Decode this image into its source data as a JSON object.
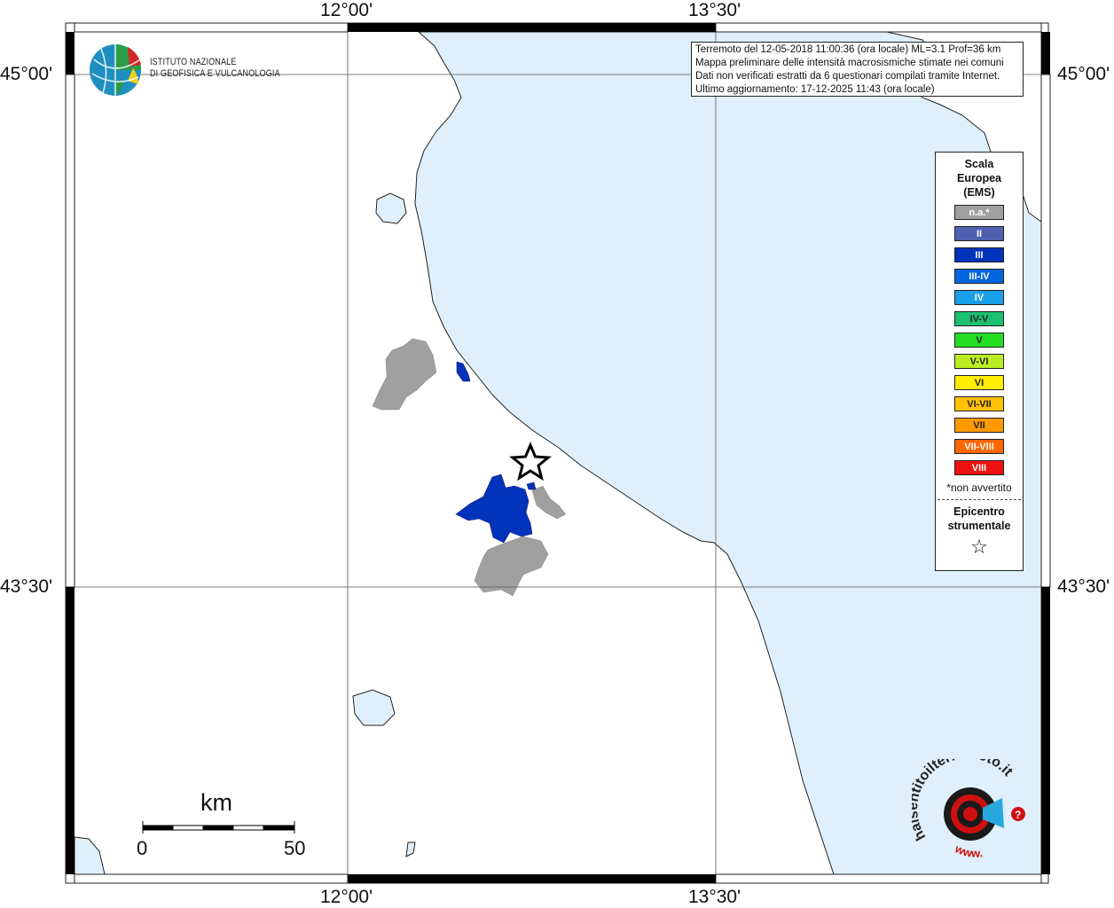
{
  "map": {
    "top_labels": [
      "12°00'",
      "13°30'"
    ],
    "bottom_labels": [
      "12°00'",
      "13°30'"
    ],
    "left_labels": [
      "45°00'",
      "43°30'"
    ],
    "right_labels": [
      "45°00'",
      "43°30'"
    ]
  },
  "info": {
    "line1": "Terremoto del 12-05-2018 11:00:36 (ora locale) ML=3.1 Prof=36 km",
    "line2": "Mappa preliminare delle intensità macrosismiche stimate nei comuni",
    "line3": "Dati non verificati estratti da 6 questionari compilati tramite Internet.",
    "line4": "Ultimo aggiornamento: 17-12-2025 11:43 (ora locale)"
  },
  "legend": {
    "title_lines": [
      "Scala",
      "Europea",
      "(EMS)"
    ],
    "entries": [
      {
        "label": "n.a.*",
        "color": "#a0a0a0"
      },
      {
        "label": "II",
        "color": "#5060b0"
      },
      {
        "label": "III",
        "color": "#0033bb"
      },
      {
        "label": "III-IV",
        "color": "#0066dd"
      },
      {
        "label": "IV",
        "color": "#1aa0e8"
      },
      {
        "label": "IV-V",
        "color": "#1ac070"
      },
      {
        "label": "V",
        "color": "#22dd22"
      },
      {
        "label": "V-VI",
        "color": "#bbee22"
      },
      {
        "label": "VI",
        "color": "#ffee00"
      },
      {
        "label": "VI-VII",
        "color": "#ffc000"
      },
      {
        "label": "VII",
        "color": "#ff9900"
      },
      {
        "label": "VII-VIII",
        "color": "#ff6600"
      },
      {
        "label": "VIII",
        "color": "#ee1111"
      }
    ],
    "note": "*non avvertito",
    "epicenter_lines": [
      "Epicentro",
      "strumentale"
    ],
    "epicenter_symbol": "☆"
  },
  "logo": {
    "line1": "ISTITUTO NAZIONALE",
    "line2": "DI GEOFISICA E VULCANOLOGIA"
  },
  "scalebar": {
    "unit": "km",
    "start": "0",
    "end": "50"
  },
  "colors": {
    "sea": "#dff0fc",
    "land": "#ffffff",
    "intensity_III": "#0033bb",
    "not_felt": "#a0a0a0"
  },
  "icons": {
    "epicenter": "star-icon",
    "ingv": "globe-logo-icon",
    "hst": "target-logo-icon"
  },
  "hst_logo": {
    "text": "haisentitoilterremoto.it",
    "www": "www."
  }
}
